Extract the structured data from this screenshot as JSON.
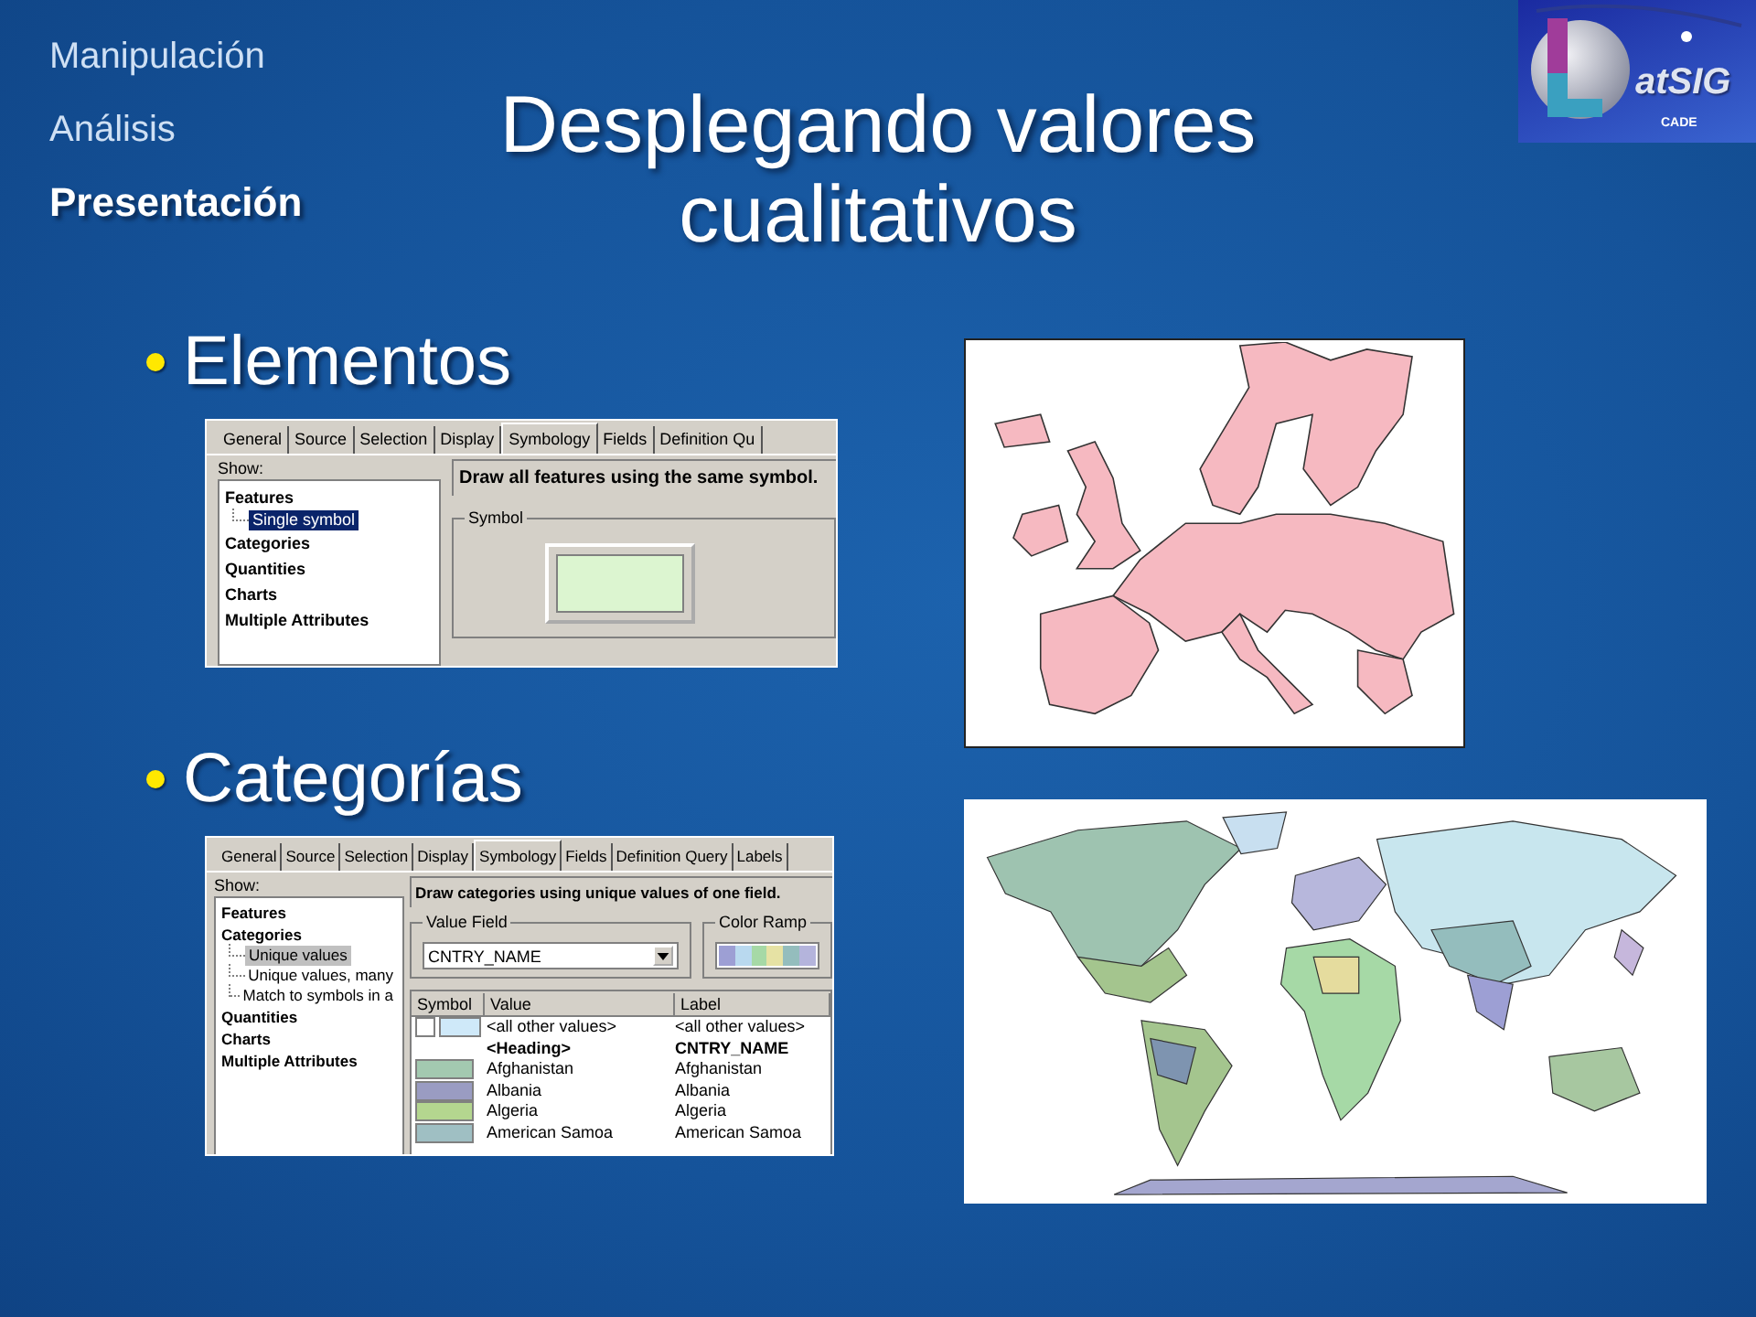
{
  "nav": [
    {
      "label": "Manipulación",
      "selected": false
    },
    {
      "label": "Análisis",
      "selected": false
    },
    {
      "label": "Presentación",
      "selected": true
    }
  ],
  "title_lines": [
    "Desplegando valores",
    "cualitativos"
  ],
  "logo": {
    "wordmark": "atSIG",
    "caption": "CADE"
  },
  "sections": [
    {
      "bullet": "Elementos",
      "map": {
        "kind": "europe"
      },
      "dialog": {
        "tabs": [
          {
            "label": "General",
            "selected": false
          },
          {
            "label": "Source",
            "selected": false
          },
          {
            "label": "Selection",
            "selected": false
          },
          {
            "label": "Display",
            "selected": false
          },
          {
            "label": "Symbology",
            "selected": true
          },
          {
            "label": "Fields",
            "selected": false
          },
          {
            "label": "Definition Qu",
            "selected": false
          }
        ],
        "show_label": "Show:",
        "tree_focused": true,
        "tree": [
          {
            "label": "Features",
            "children": [
              {
                "label": "Single symbol",
                "selected": true
              }
            ]
          },
          {
            "label": "Categories"
          },
          {
            "label": "Quantities"
          },
          {
            "label": "Charts"
          },
          {
            "label": "Multiple Attributes"
          }
        ],
        "description": "Draw all features using the same symbol.",
        "symbol_group": {
          "label": "Symbol",
          "color": "#dcf5d0"
        }
      }
    },
    {
      "bullet": "Categorías",
      "map": {
        "kind": "world"
      },
      "dialog": {
        "tabs": [
          {
            "label": "General",
            "selected": false
          },
          {
            "label": "Source",
            "selected": false
          },
          {
            "label": "Selection",
            "selected": false
          },
          {
            "label": "Display",
            "selected": false
          },
          {
            "label": "Symbology",
            "selected": true
          },
          {
            "label": "Fields",
            "selected": false
          },
          {
            "label": "Definition Query",
            "selected": false
          },
          {
            "label": "Labels",
            "selected": false
          }
        ],
        "show_label": "Show:",
        "tree_focused": false,
        "tree": [
          {
            "label": "Features"
          },
          {
            "label": "Categories",
            "children": [
              {
                "label": "Unique values",
                "selected": true
              },
              {
                "label": "Unique values, many",
                "selected": false
              },
              {
                "label": "Match to symbols in a",
                "selected": false
              }
            ]
          },
          {
            "label": "Quantities"
          },
          {
            "label": "Charts"
          },
          {
            "label": "Multiple Attributes"
          }
        ],
        "description": "Draw categories using unique values of one field.",
        "value_field": {
          "label": "Value Field",
          "value": "CNTRY_NAME"
        },
        "color_ramp": {
          "label": "Color Ramp",
          "colors": [
            {
              "color": "#9d9fd4"
            },
            {
              "color": "#b9d9ef"
            },
            {
              "color": "#a6d9a6"
            },
            {
              "color": "#e6e2a4"
            },
            {
              "color": "#94bdbd"
            },
            {
              "color": "#b4b4dc"
            }
          ]
        },
        "table": {
          "columns": [
            "Symbol",
            "Value",
            "Label"
          ],
          "rows": [
            {
              "kind": "value",
              "symbols": [
                {
                  "color": "#ffffff"
                },
                {
                  "color": "#cfe9f9"
                }
              ],
              "value": "<all other values>",
              "label": "<all other values>"
            },
            {
              "kind": "heading",
              "symbols": [],
              "value": "<Heading>",
              "label": "CNTRY_NAME"
            },
            {
              "kind": "value",
              "symbols": [
                {
                  "color": "#a3c9b0"
                }
              ],
              "value": "Afghanistan",
              "label": "Afghanistan"
            },
            {
              "kind": "value",
              "symbols": [
                {
                  "color": "#9a9cc2"
                }
              ],
              "value": "Albania",
              "label": "Albania"
            },
            {
              "kind": "value",
              "symbols": [
                {
                  "color": "#b4d68f"
                }
              ],
              "value": "Algeria",
              "label": "Algeria"
            },
            {
              "kind": "value",
              "symbols": [
                {
                  "color": "#9fbfc3"
                }
              ],
              "value": "American Samoa",
              "label": "American Samoa"
            }
          ]
        }
      }
    }
  ]
}
